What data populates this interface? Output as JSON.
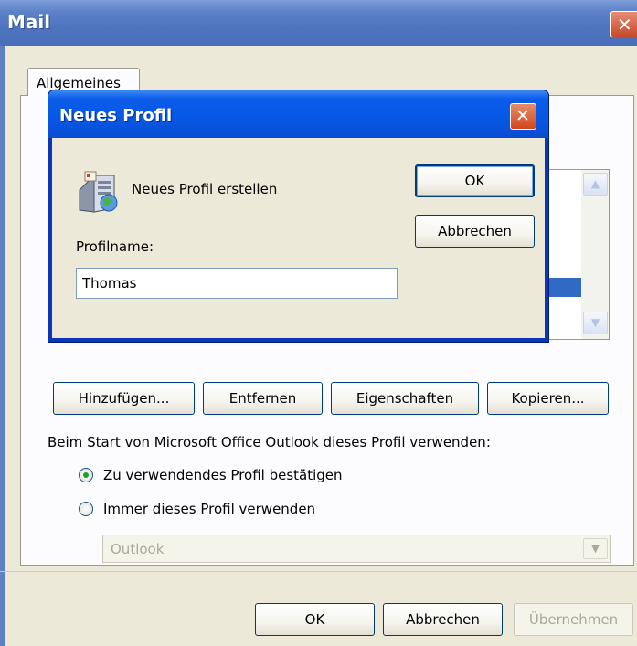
{
  "mail_window": {
    "title": "Mail",
    "tabs": [
      {
        "label": "Allgemeines"
      }
    ],
    "buttons": {
      "add": "Hinzufügen...",
      "remove": "Entfernen",
      "properties": "Eigenschaften",
      "copy": "Kopieren..."
    },
    "startup_label": "Beim Start von Microsoft Office Outlook dieses Profil verwenden:",
    "radio_options": [
      {
        "label": "Zu verwendendes Profil bestätigen",
        "selected": true
      },
      {
        "label": "Immer dieses Profil verwenden",
        "selected": false
      }
    ],
    "profile_select": {
      "value": "Outlook",
      "enabled": false
    },
    "footer": {
      "ok": "OK",
      "cancel": "Abbrechen",
      "apply": "Übernehmen",
      "apply_enabled": false
    }
  },
  "dialog": {
    "title": "Neues Profil",
    "heading": "Neues Profil erstellen",
    "profile_name_label": "Profilname:",
    "profile_name_value": "Thomas",
    "ok": "OK",
    "cancel": "Abbrechen"
  },
  "icons": {
    "window_close": "close-icon",
    "dialog_close": "close-icon",
    "profile": "profile-server-icon",
    "scroll_up": "scroll-up-arrow-icon",
    "scroll_down": "scroll-down-arrow-icon",
    "dropdown": "chevron-down-icon"
  },
  "colors": {
    "xp_title_active": "#0758e5",
    "xp_title_inactive": "#7d9ed8",
    "xp_face": "#ece9d8",
    "selection": "#316ac5",
    "close_red": "#d1461c",
    "radio_dot": "#21a121"
  }
}
